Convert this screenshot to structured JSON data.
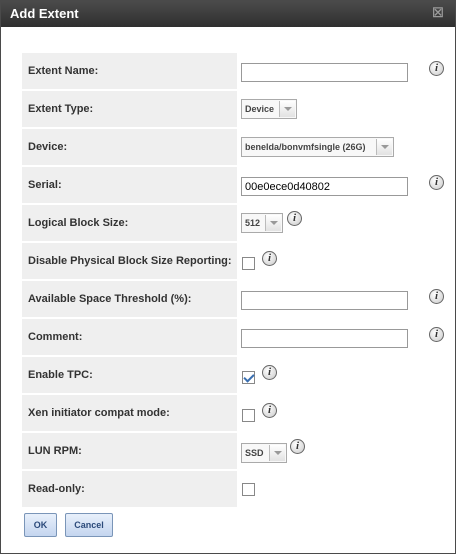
{
  "dialog": {
    "title": "Add Extent",
    "close_glyph": "☒"
  },
  "fields": {
    "extent_name": {
      "label": "Extent Name:",
      "value": ""
    },
    "extent_type": {
      "label": "Extent Type:",
      "selected": "Device"
    },
    "device": {
      "label": "Device:",
      "selected": "benelda/bonvmfsingle (26G)"
    },
    "serial": {
      "label": "Serial:",
      "value": "00e0ece0d40802"
    },
    "logical_block_size": {
      "label": "Logical Block Size:",
      "selected": "512"
    },
    "disable_physical": {
      "label": "Disable Physical Block Size Reporting:",
      "checked": false
    },
    "available_space": {
      "label": "Available Space Threshold (%):",
      "value": ""
    },
    "comment": {
      "label": "Comment:",
      "value": ""
    },
    "enable_tpc": {
      "label": "Enable TPC:",
      "checked": true
    },
    "xen_compat": {
      "label": "Xen initiator compat mode:",
      "checked": false
    },
    "lun_rpm": {
      "label": "LUN RPM:",
      "selected": "SSD"
    },
    "read_only": {
      "label": "Read-only:",
      "checked": false
    }
  },
  "buttons": {
    "ok": "OK",
    "cancel": "Cancel"
  },
  "icons": {
    "info": "i"
  }
}
